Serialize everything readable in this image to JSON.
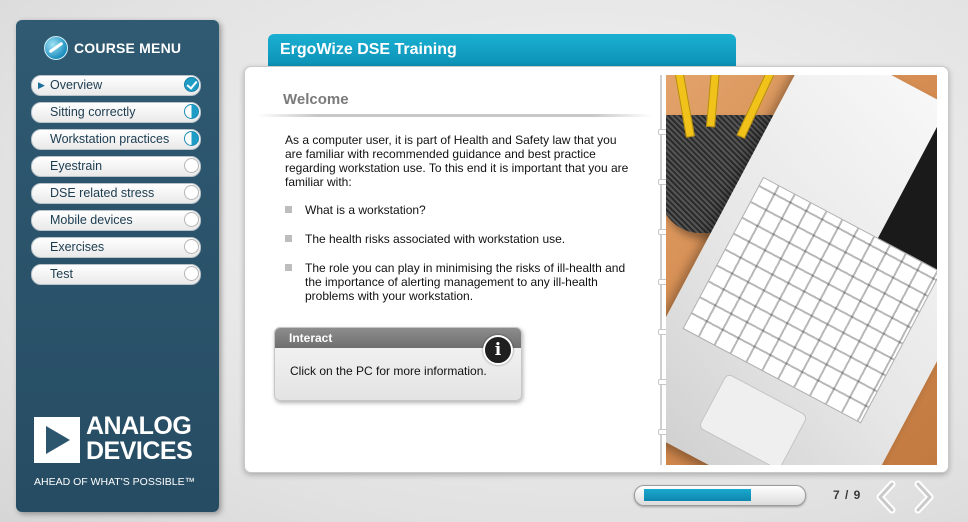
{
  "sidebar": {
    "title": "COURSE MENU",
    "items": [
      {
        "label": "Overview",
        "status": "complete",
        "active": true
      },
      {
        "label": "Sitting correctly",
        "status": "partial"
      },
      {
        "label": "Workstation practices",
        "status": "partial"
      },
      {
        "label": "Eyestrain",
        "status": "not-started"
      },
      {
        "label": "DSE related stress",
        "status": "not-started"
      },
      {
        "label": "Mobile devices",
        "status": "not-started"
      },
      {
        "label": "Exercises",
        "status": "not-started"
      },
      {
        "label": "Test",
        "status": "not-started"
      }
    ],
    "brand": {
      "name_line1": "ANALOG",
      "name_line2": "DEVICES",
      "tagline": "AHEAD OF WHAT'S POSSIBLE™"
    }
  },
  "header": {
    "title": "ErgoWize DSE Training"
  },
  "content": {
    "heading": "Welcome",
    "intro": "As a computer user, it is part of Health and Safety law that you are familiar with recommended guidance and best practice regarding workstation use. To this end it is important that you are familiar with:",
    "bullets": [
      "What is a workstation?",
      "The health risks associated with workstation use.",
      "The role you can play in minimising the risks of ill-health and the importance of alerting management to any ill-health problems with your workstation."
    ],
    "interact": {
      "title": "Interact",
      "icon": "info-icon",
      "text": "Click on the PC for more information."
    }
  },
  "footer": {
    "page_label": "7 / 9",
    "progress_fraction": 0.71
  },
  "colors": {
    "accent": "#1aa8cf",
    "sidebar_bg": "#2b566e"
  }
}
